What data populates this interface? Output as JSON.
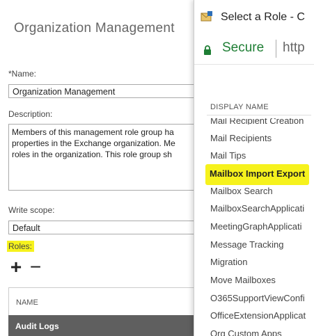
{
  "eac": {
    "page_title": "Organization Management",
    "name_label": "*Name:",
    "name_value": "Organization Management",
    "description_label": "Description:",
    "description_lines": [
      "Members of this management role group ha",
      "properties in the Exchange organization. Me",
      "roles in the organization. This role group sh"
    ],
    "write_scope_label": "Write scope:",
    "write_scope_value": "Default",
    "roles_label": "Roles:",
    "add_glyph": "+",
    "remove_glyph": "−",
    "table_column_name": "NAME",
    "selected_row": "Audit Logs",
    "highlight_color": "#f6f21d"
  },
  "popup": {
    "window_title": "Select a Role - C",
    "secure_text": "Secure",
    "url_text": "http",
    "list_header": "DISPLAY NAME",
    "roles": [
      "Mail Recipient Creation",
      "Mail Recipients",
      "Mail Tips",
      "Mailbox Import Export",
      "Mailbox Search",
      "MailboxSearchApplicati",
      "MeetingGraphApplicati",
      "Message Tracking",
      "Migration",
      "Move Mailboxes",
      "O365SupportViewConfi",
      "OfficeExtensionApplicat",
      "Org Custom Apps"
    ],
    "selected_role": "Mailbox Import Export",
    "secure_color": "#1e7e34"
  }
}
